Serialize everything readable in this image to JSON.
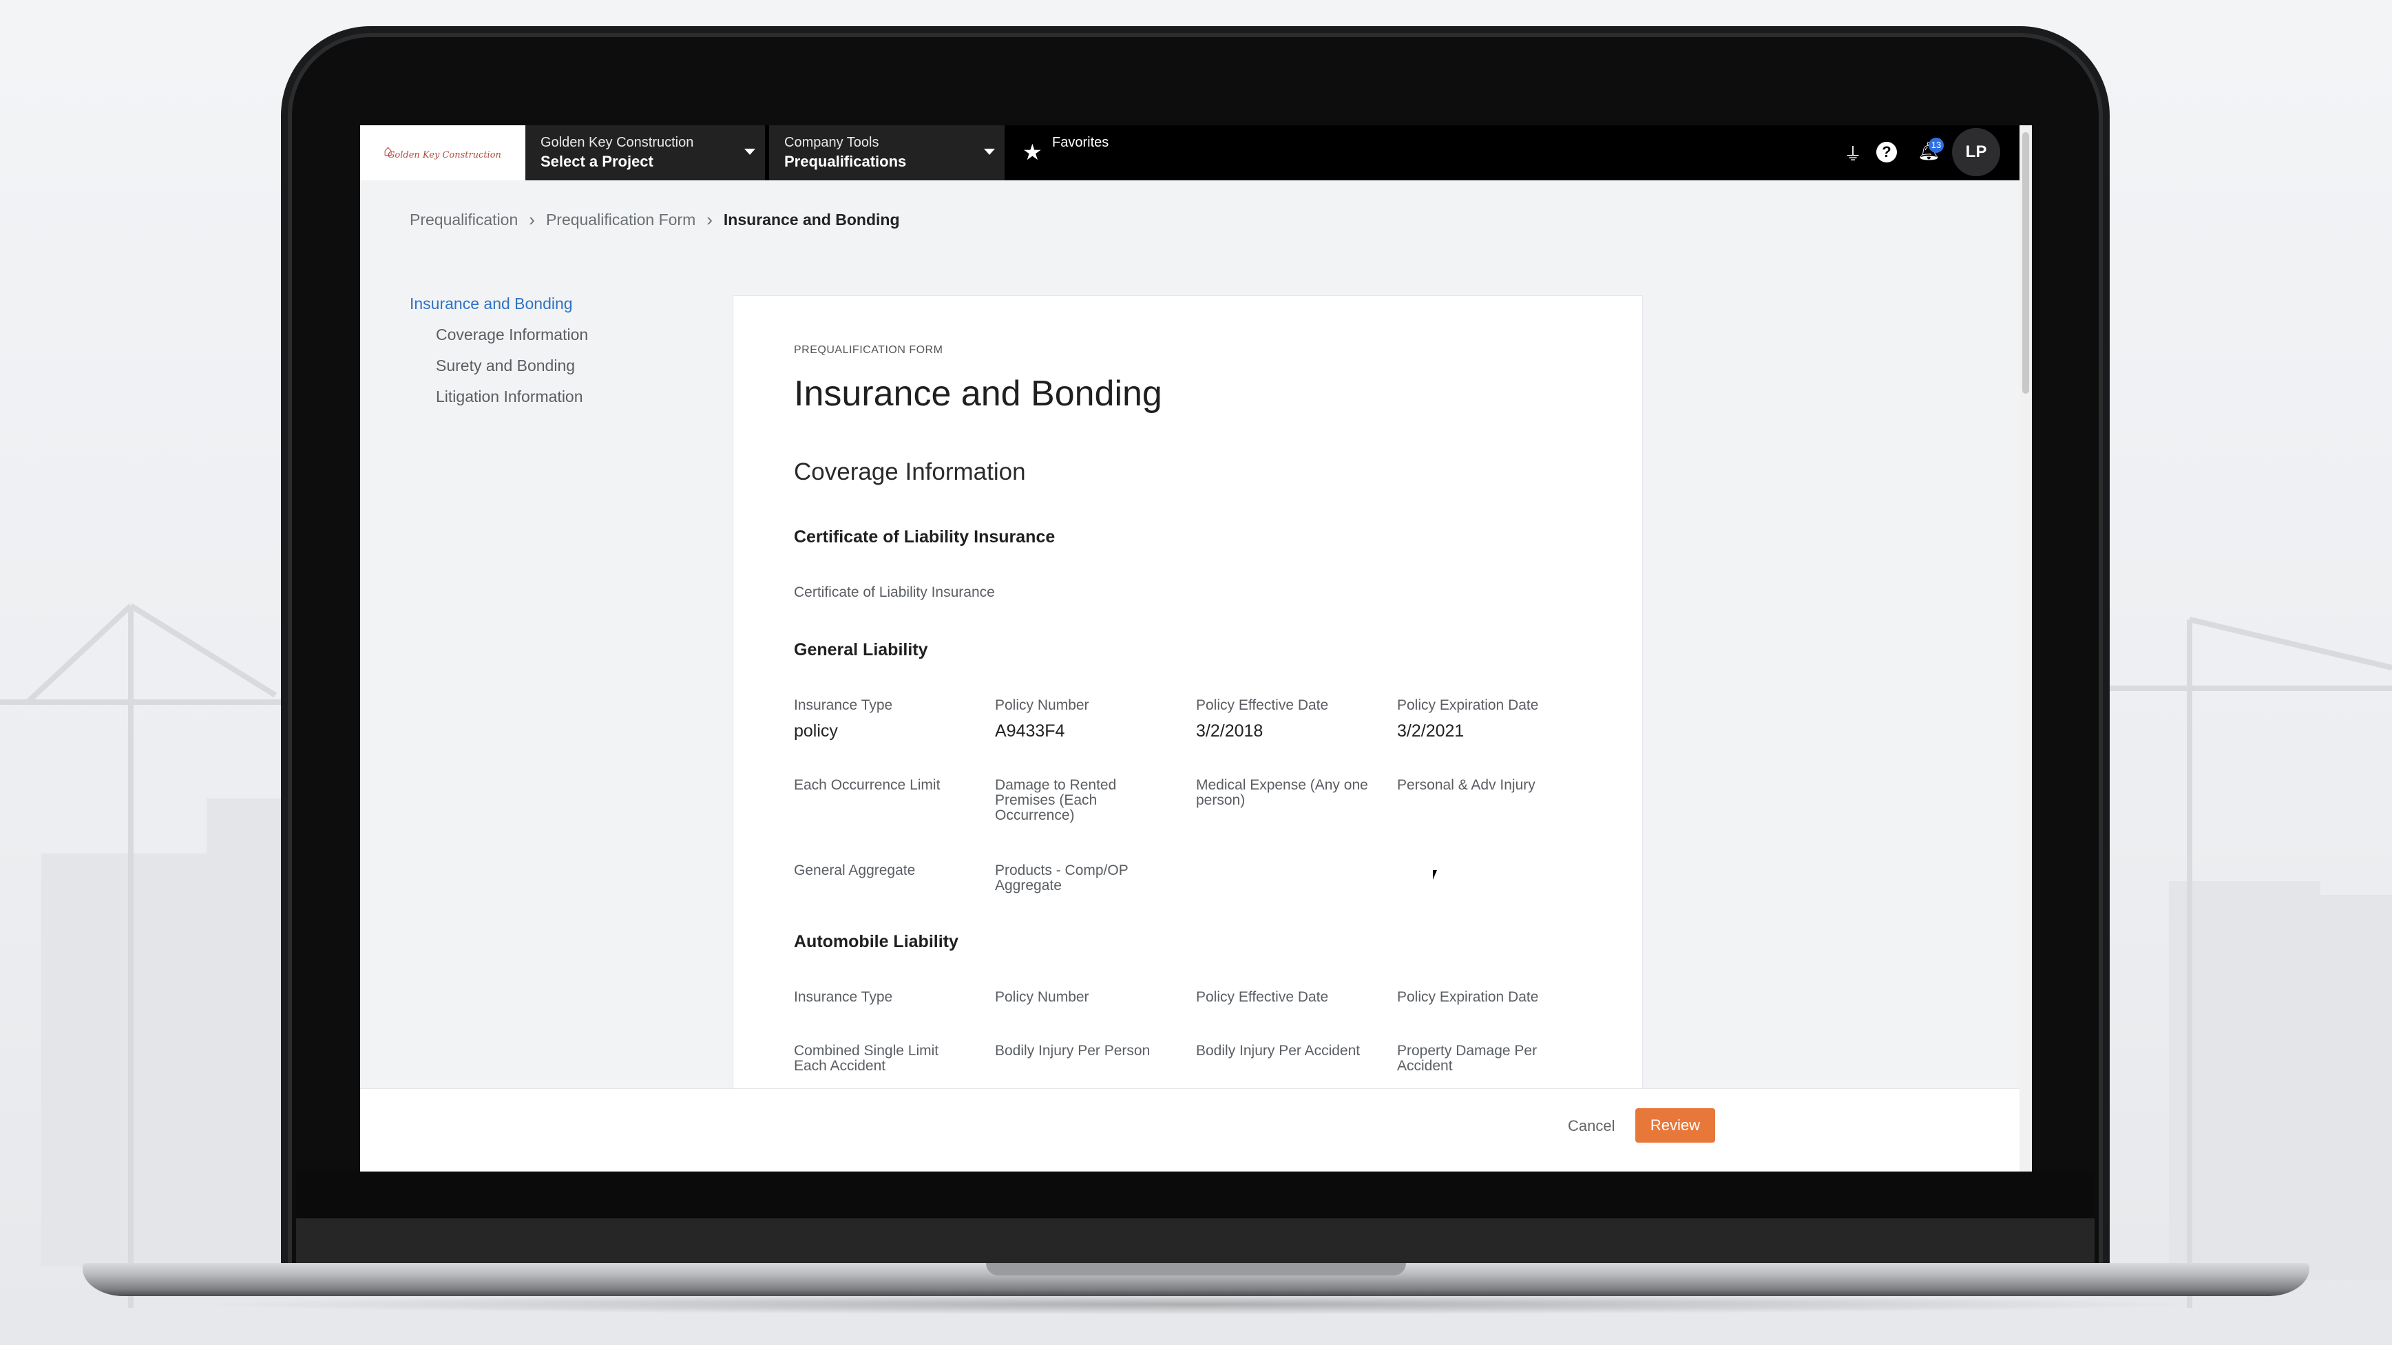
{
  "topbar": {
    "logo_text": "Golden Key Construction",
    "project_dropdown": {
      "label": "Golden Key Construction",
      "value": "Select a Project"
    },
    "tools_dropdown": {
      "label": "Company Tools",
      "value": "Prequalifications"
    },
    "favorites_label": "Favorites",
    "notification_count": "13",
    "avatar_initials": "LP",
    "icons": [
      "plug-icon",
      "help-icon",
      "bell-icon",
      "star-icon"
    ]
  },
  "breadcrumb": [
    "Prequalification",
    "Prequalification Form",
    "Insurance and Bonding"
  ],
  "leftnav": {
    "top": "Insurance and Bonding",
    "items": [
      "Coverage Information",
      "Surety and Bonding",
      "Litigation Information"
    ]
  },
  "form": {
    "eyebrow": "PREQUALIFICATION FORM",
    "title": "Insurance and Bonding",
    "section": "Coverage Information",
    "cert_heading": "Certificate of Liability Insurance",
    "cert_field": "Certificate of Liability Insurance",
    "general": {
      "heading": "General Liability",
      "row1": [
        {
          "label": "Insurance Type",
          "value": "policy"
        },
        {
          "label": "Policy Number",
          "value": "A9433F4"
        },
        {
          "label": "Policy Effective Date",
          "value": "3/2/2018"
        },
        {
          "label": "Policy Expiration Date",
          "value": "3/2/2021"
        }
      ],
      "row2": [
        "Each Occurrence Limit",
        "Damage to Rented Premises (Each Occurrence)",
        "Medical Expense (Any one person)",
        "Personal & Adv Injury"
      ],
      "row3": [
        "General Aggregate",
        "Products - Comp/OP Aggregate"
      ]
    },
    "auto": {
      "heading": "Automobile Liability",
      "row1": [
        "Insurance Type",
        "Policy Number",
        "Policy Effective Date",
        "Policy Expiration Date"
      ],
      "row2": [
        "Combined Single Limit Each Accident",
        "Bodily Injury Per Person",
        "Bodily Injury Per Accident",
        "Property Damage Per Accident"
      ]
    }
  },
  "footer": {
    "cancel": "Cancel",
    "review": "Review"
  },
  "colors": {
    "accent": "#e8773a",
    "link": "#2f72c4",
    "topbar": "#000000"
  }
}
